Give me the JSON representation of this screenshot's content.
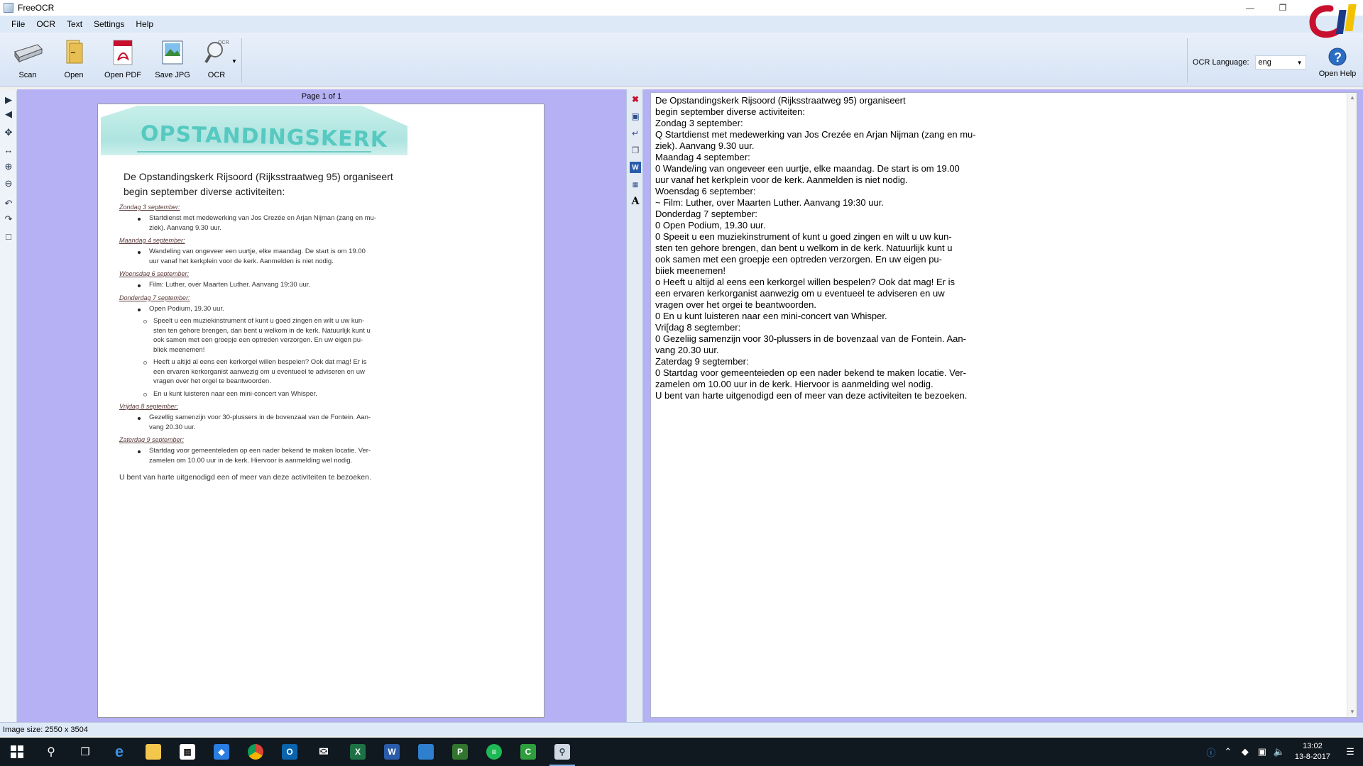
{
  "window": {
    "title": "FreeOCR"
  },
  "menu": [
    "File",
    "OCR",
    "Text",
    "Settings",
    "Help"
  ],
  "toolbar": {
    "scan": "Scan",
    "open": "Open",
    "open_pdf": "Open PDF",
    "save_jpg": "Save JPG",
    "ocr": "OCR",
    "ocr_language_label": "OCR Language:",
    "ocr_language_value": "eng",
    "open_help": "Open Help"
  },
  "image_pane": {
    "page_info": "Page 1 of 1",
    "scan": {
      "banner": "OPSTANDINGSKERK",
      "heading1": "De Opstandingskerk Rijsoord (Rijksstraatweg 95) organiseert",
      "heading2": "begin september diverse activiteiten:",
      "lines": [
        {
          "kind": "sub",
          "text": "Zondag 3 september:"
        },
        {
          "kind": "bullet",
          "text": "Startdienst met medewerking van Jos Crezée en Arjan Nijman (zang en mu-"
        },
        {
          "kind": "cont",
          "text": "ziek). Aanvang 9.30 uur."
        },
        {
          "kind": "sub",
          "text": "Maandag 4 september:"
        },
        {
          "kind": "bullet",
          "text": "Wandeling van ongeveer een uurtje, elke maandag. De start is om 19.00"
        },
        {
          "kind": "cont",
          "text": "uur vanaf het kerkplein voor de kerk. Aanmelden is niet nodig."
        },
        {
          "kind": "sub",
          "text": "Woensdag 6 september:"
        },
        {
          "kind": "bullet",
          "text": "Film: Luther, over Maarten Luther. Aanvang 19:30 uur."
        },
        {
          "kind": "sub",
          "text": "Donderdag 7 september:"
        },
        {
          "kind": "bullet",
          "text": "Open Podium, 19.30 uur."
        },
        {
          "kind": "obullet",
          "text": "Speelt u een muziekinstrument of kunt u goed zingen en wilt u uw kun-"
        },
        {
          "kind": "ocont",
          "text": "sten ten gehore brengen, dan bent u welkom in de kerk. Natuurlijk kunt u"
        },
        {
          "kind": "ocont",
          "text": "ook samen met een groepje een optreden verzorgen.  En uw eigen pu-"
        },
        {
          "kind": "ocont",
          "text": "bliek meenemen!"
        },
        {
          "kind": "obullet",
          "text": "Heeft u altijd al eens een kerkorgel willen bespelen? Ook dat mag! Er is"
        },
        {
          "kind": "ocont",
          "text": "een ervaren kerkorganist aanwezig om u eventueel te adviseren en uw"
        },
        {
          "kind": "ocont",
          "text": "vragen over het orgel te beantwoorden."
        },
        {
          "kind": "obullet",
          "text": "En u kunt luisteren naar een mini-concert van Whisper."
        },
        {
          "kind": "sub",
          "text": "Vrijdag 8 september:"
        },
        {
          "kind": "bullet",
          "text": "Gezellig samenzijn voor 30-plussers in de bovenzaal van de Fontein. Aan-"
        },
        {
          "kind": "cont",
          "text": "vang 20.30 uur."
        },
        {
          "kind": "sub",
          "text": "Zaterdag 9 september:"
        },
        {
          "kind": "bullet",
          "text": "Startdag voor gemeenteleden op een nader bekend te maken locatie. Ver-"
        },
        {
          "kind": "cont",
          "text": "zamelen om 10.00 uur in de kerk. Hiervoor is aanmelding wel nodig."
        },
        {
          "kind": "final",
          "text": "U bent van harte uitgenodigd een of meer van deze activiteiten te bezoeken."
        }
      ]
    }
  },
  "ocr_text": [
    "De Opstandingskerk Rijsoord (Rijksstraatweg 95) organiseert",
    "begin september diverse activiteiten:",
    "Zondag 3 september:",
    "Q Startdienst met medewerking van Jos Crezée en Arjan Nijman (zang en mu-",
    "ziek). Aanvang 9.30 uur.",
    "Maandag 4 september:",
    "0 Wande/ing van ongeveer een uurtje, elke maandag. De start is om 19.00",
    "uur vanaf het kerkplein voor de kerk. Aanmelden is niet nodig.",
    "Woensdag 6 september:",
    "~ Film: Luther, over Maarten Luther. Aanvang 19:30 uur.",
    "Donderdag 7 september:",
    "0 Open Podium, 19.30 uur.",
    "0 Speeit u een muziekinstrument of kunt u goed zingen en wilt u uw kun-",
    "sten ten gehore brengen, dan bent u welkom in de kerk. Natuurlijk kunt u",
    "ook samen met een groepje een optreden verzorgen. En uw eigen pu-",
    "biiek meenemen!",
    "o Heeft u altijd al eens een kerkorgel willen bespelen? Ook dat mag! Er is",
    "een ervaren kerkorganist aanwezig om u eventueel te adviseren en uw",
    "vragen over het orgei te beantwoorden.",
    "0 En u kunt luisteren naar een mini-concert van Whisper.",
    "Vri[dag 8 segtember:",
    "0 Gezeliig samenzijn voor 30-plussers in de bovenzaal van de Fontein. Aan-",
    "vang 20.30 uur.",
    "Zaterdag 9 segtember:",
    "0 Startdag voor gemeenteieden op een nader bekend te maken locatie. Ver-",
    "zamelen om 10.00 uur in de kerk. Hiervoor is aanmelding wel nodig.",
    "U bent van harte uitgenodigd een of meer van deze activiteiten te bezoeken."
  ],
  "status": {
    "image_size": "Image size:  2550 x 3504"
  },
  "taskbar": {
    "apps": [
      "windows-start",
      "search",
      "task-view",
      "edge",
      "file-explorer",
      "store",
      "dropbox",
      "chrome",
      "outlook",
      "mail",
      "excel",
      "word",
      "explorer-window",
      "project",
      "spotify",
      "camtasia",
      "freeocr"
    ],
    "time": "13:02",
    "date": "13-8-2017"
  },
  "colors": {
    "pane_bg": "#b6b1f4",
    "menu_bg": "#dde9f7",
    "taskbar_bg": "#101820"
  }
}
